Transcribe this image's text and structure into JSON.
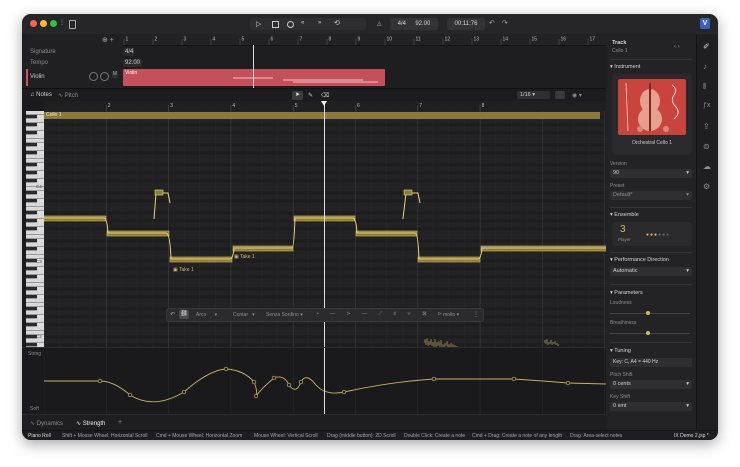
{
  "titlebar": {
    "time_signature": "4/4",
    "tempo": "92.00",
    "time": "00:11:76"
  },
  "ruler_top": [
    "1",
    "2",
    "3",
    "4",
    "5",
    "6",
    "7",
    "8",
    "9",
    "10",
    "11",
    "12",
    "13",
    "14",
    "15",
    "16",
    "17"
  ],
  "tracks_header": {
    "signature_label": "Signature",
    "signature_value": "4/4",
    "tempo_label": "Tempo",
    "tempo_value": "92.00",
    "violin_label": "Violin",
    "m_btn": "M",
    "clip_label": "Violin"
  },
  "tabs": {
    "notes": "Notes",
    "pitch": "Pitch",
    "quantize": "1/16"
  },
  "roll_ruler": [
    "2",
    "3",
    "4",
    "5",
    "6",
    "7",
    "8"
  ],
  "roll": {
    "clip_label": "Cello 1",
    "octaves": [
      "C4",
      "C3",
      "C2"
    ],
    "take_labels": [
      "Take 1",
      "Take 1"
    ],
    "string_label": "String",
    "soft_label": "Soft"
  },
  "floating_toolbar": {
    "articulation": "Arco",
    "style": "Contar",
    "technique": "Senza Sordino",
    "extra": "molto"
  },
  "bottom_tabs": {
    "dynamics": "Dynamics",
    "strength": "Strength",
    "add": "+"
  },
  "right_panel": {
    "track_title": "Track",
    "track_name": "Cello 1",
    "instrument_title": "Instrument",
    "instrument_name": "Orchestral Cello 1",
    "version_label": "Version",
    "version_value": "90",
    "preset_label": "Preset",
    "preset_value": "Default*",
    "ensemble_title": "Ensemble",
    "ensemble_count": "3",
    "ensemble_unit": "Player",
    "performance_title": "Performance Direction",
    "performance_value": "Automatic",
    "parameters_title": "Parameters",
    "loudness_label": "Loudness",
    "breathiness_label": "Breathiness",
    "tuning_title": "Tuning",
    "tuning_value": "Key: C, A4 = 440 Hz",
    "pitch_shift_label": "Pitch Shift",
    "pitch_shift_value": "0 cents",
    "key_shift_label": "Key Shift",
    "key_shift_value": "0 smt"
  },
  "statusbar": {
    "mode": "Piano Roll",
    "hint1": "Shift + Mouse Wheel: Horizontal Scroll",
    "hint2": "Cmd + Mouse Wheel: Horizontal Zoom",
    "hint3": "Mouse Wheel: Vertical Scroll",
    "hint4": "Drag (middle button): 2D Scroll",
    "hint5": "Double Click: Create a note",
    "hint6": "Cmd + Drag: Create a note of any length",
    "hint7": "Drag: Area-select notes",
    "project": "IX Demo 2.jsp *"
  },
  "colors": {
    "accent": "#c9b35a",
    "clip": "#c4505c",
    "instrument_bg": "#c8443c"
  }
}
